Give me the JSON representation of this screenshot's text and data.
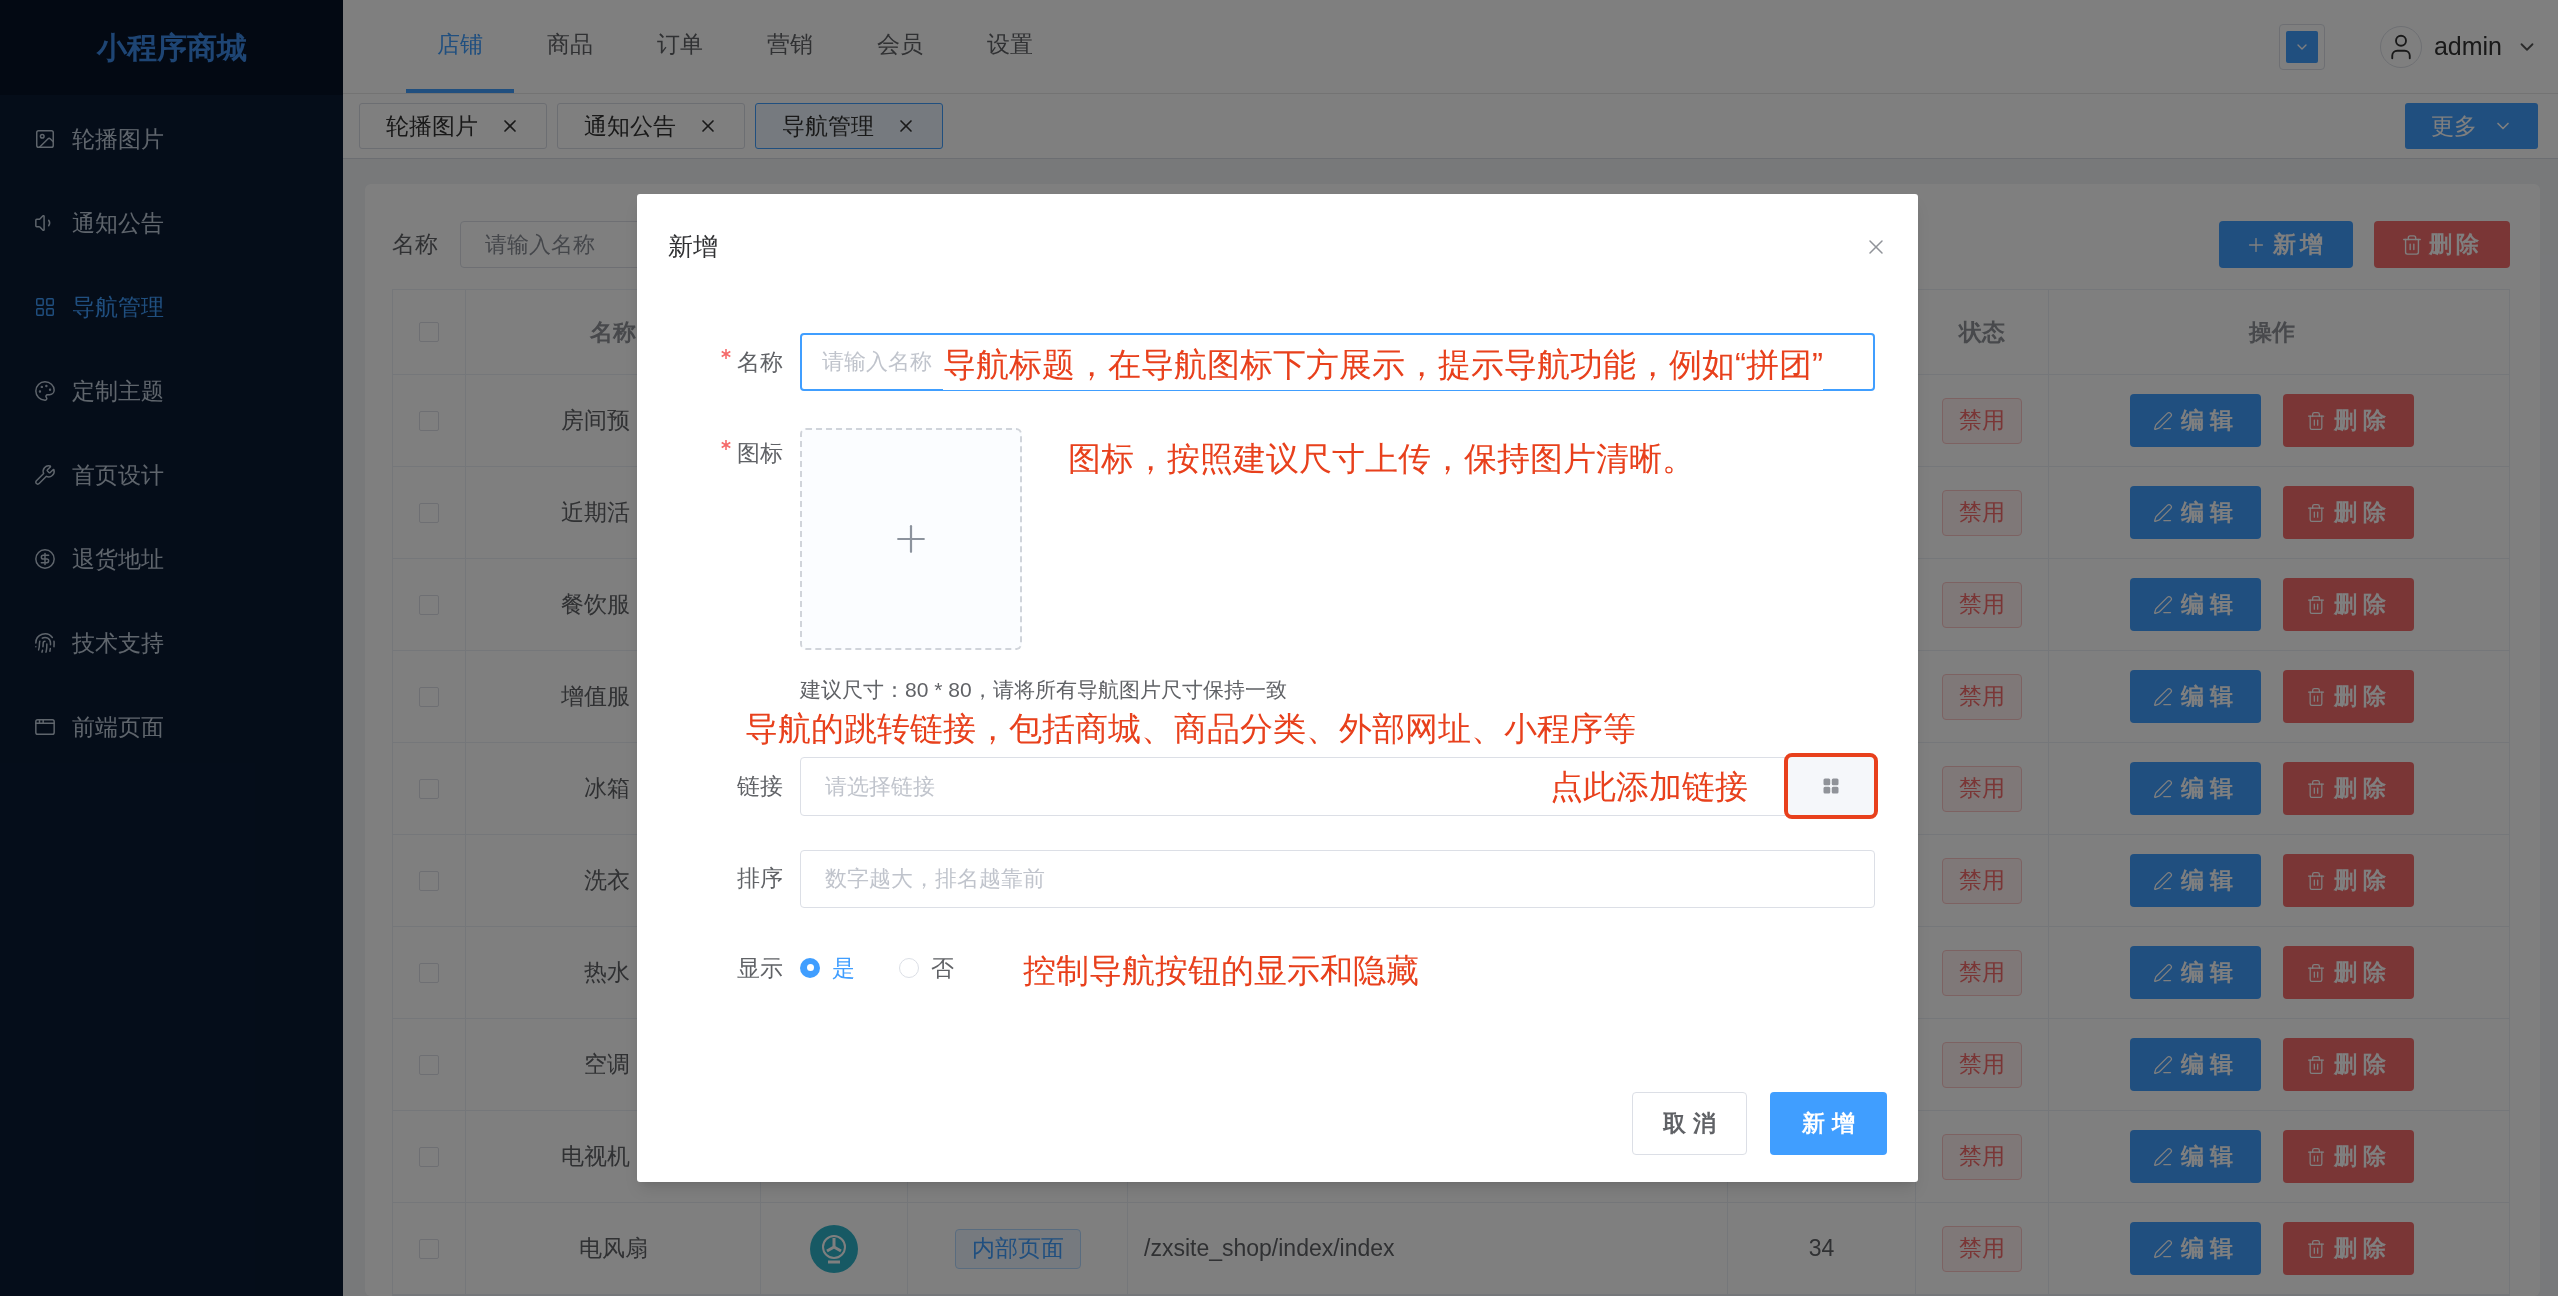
{
  "sidebar": {
    "title": "小程序商城",
    "items": [
      {
        "label": "轮播图片",
        "selected": false
      },
      {
        "label": "通知公告",
        "selected": false
      },
      {
        "label": "导航管理",
        "selected": true
      },
      {
        "label": "定制主题",
        "selected": false
      },
      {
        "label": "首页设计",
        "selected": false
      },
      {
        "label": "退货地址",
        "selected": false
      },
      {
        "label": "技术支持",
        "selected": false
      },
      {
        "label": "前端页面",
        "selected": false
      }
    ]
  },
  "header": {
    "nav": [
      {
        "label": "店铺",
        "selected": true
      },
      {
        "label": "商品",
        "selected": false
      },
      {
        "label": "订单",
        "selected": false
      },
      {
        "label": "营销",
        "selected": false
      },
      {
        "label": "会员",
        "selected": false
      },
      {
        "label": "设置",
        "selected": false
      }
    ],
    "user": "admin"
  },
  "tabs": [
    {
      "label": "轮播图片",
      "selected": false
    },
    {
      "label": "通知公告",
      "selected": false
    },
    {
      "label": "导航管理",
      "selected": true
    }
  ],
  "more_button": "更多",
  "search": {
    "label": "名称",
    "placeholder": "请输入名称"
  },
  "toolbar": {
    "add": "新增",
    "delete": "删除"
  },
  "table": {
    "select_all": {
      "checked": false
    },
    "columns": [
      "名称",
      "状态",
      "操作"
    ],
    "rows": [
      {
        "name": "房间预",
        "checked": false,
        "status": "禁用",
        "edit": "编辑",
        "delete": "删除"
      },
      {
        "name": "近期活",
        "checked": false,
        "status": "禁用",
        "edit": "编辑",
        "delete": "删除"
      },
      {
        "name": "餐饮服",
        "checked": false,
        "status": "禁用",
        "edit": "编辑",
        "delete": "删除"
      },
      {
        "name": "增值服",
        "checked": false,
        "status": "禁用",
        "edit": "编辑",
        "delete": "删除"
      },
      {
        "name": "冰箱",
        "checked": false,
        "status": "禁用",
        "edit": "编辑",
        "delete": "删除"
      },
      {
        "name": "洗衣",
        "checked": false,
        "status": "禁用",
        "edit": "编辑",
        "delete": "删除"
      },
      {
        "name": "热水",
        "checked": false,
        "status": "禁用",
        "edit": "编辑",
        "delete": "删除"
      },
      {
        "name": "空调",
        "checked": false,
        "status": "禁用",
        "edit": "编辑",
        "delete": "删除"
      },
      {
        "name": "电视机",
        "checked": false,
        "status": "禁用",
        "edit": "编辑",
        "delete": "删除"
      },
      {
        "name": "电风扇",
        "checked": false,
        "type": "内部页面",
        "link": "/zxsite_shop/index/index",
        "sort": "34",
        "status": "禁用",
        "edit": "编辑",
        "delete": "删除"
      }
    ]
  },
  "dialog": {
    "title": "新增",
    "name": {
      "label": "名称",
      "required": true,
      "placeholder": "请输入名称"
    },
    "icon": {
      "label": "图标",
      "required": true,
      "hint": "建议尺寸：80 * 80，请将所有导航图片尺寸保持一致"
    },
    "link": {
      "label": "链接",
      "placeholder": "请选择链接"
    },
    "sort": {
      "label": "排序",
      "placeholder": "数字越大，排名越靠前"
    },
    "show": {
      "label": "显示",
      "options": [
        {
          "label": "是",
          "selected": true
        },
        {
          "label": "否",
          "selected": false
        }
      ]
    },
    "buttons": {
      "cancel": "取 消",
      "confirm": "新 增"
    },
    "annotations": {
      "name": "导航标题，在导航图标下方展示，提示导航功能，例如“拼团”",
      "icon": "图标，按照建议尺寸上传，保持图片清晰。",
      "link": "导航的跳转链接，包括商城、商品分类、外部网址、小程序等",
      "link_button": "点此添加链接",
      "show": "控制导航按钮的显示和隐藏"
    }
  }
}
